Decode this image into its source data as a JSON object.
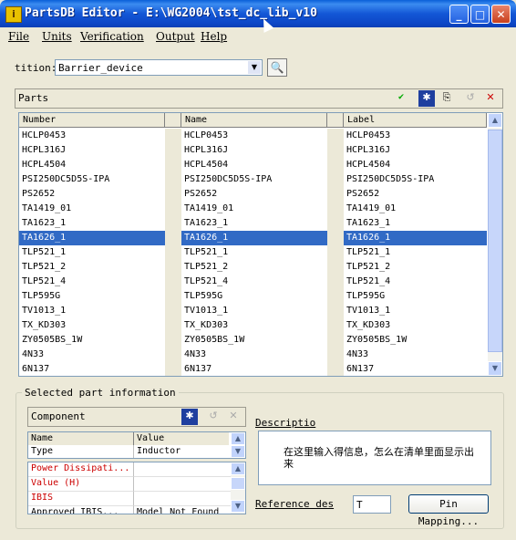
{
  "window": {
    "title": "PartsDB Editor - E:\\WG2004\\tst_dc_lib_v10",
    "minimize": "_",
    "maximize": "□",
    "close": "✕",
    "app_icon": "i"
  },
  "menu": {
    "file": "File",
    "units": "Units",
    "verification": "Verification",
    "output": "Output",
    "help": "Help"
  },
  "partition": {
    "label": "tition:",
    "value": "Barrier_device"
  },
  "parts": {
    "title": "Parts",
    "columns": [
      "Number",
      "Name",
      "Label"
    ],
    "rows": [
      [
        "HCLP0453",
        "HCLP0453",
        "HCLP0453"
      ],
      [
        "HCPL316J",
        "HCPL316J",
        "HCPL316J"
      ],
      [
        "HCPL4504",
        "HCPL4504",
        "HCPL4504"
      ],
      [
        "PSI250DC5D5S-IPA",
        "PSI250DC5D5S-IPA",
        "PSI250DC5D5S-IPA"
      ],
      [
        "PS2652",
        "PS2652",
        "PS2652"
      ],
      [
        "TA1419_01",
        "TA1419_01",
        "TA1419_01"
      ],
      [
        "TA1623_1",
        "TA1623_1",
        "TA1623_1"
      ],
      [
        "TA1626_1",
        "TA1626_1",
        "TA1626_1"
      ],
      [
        "TLP521_1",
        "TLP521_1",
        "TLP521_1"
      ],
      [
        "TLP521_2",
        "TLP521_2",
        "TLP521_2"
      ],
      [
        "TLP521_4",
        "TLP521_4",
        "TLP521_4"
      ],
      [
        "TLP595G",
        "TLP595G",
        "TLP595G"
      ],
      [
        "TV1013_1",
        "TV1013_1",
        "TV1013_1"
      ],
      [
        "TX_KD303",
        "TX_KD303",
        "TX_KD303"
      ],
      [
        "ZY0505BS_1W",
        "ZY0505BS_1W",
        "ZY0505BS_1W"
      ],
      [
        "4N33",
        "4N33",
        "4N33"
      ],
      [
        "6N137",
        "6N137",
        "6N137"
      ]
    ],
    "selected_index": 7
  },
  "info": {
    "legend": "Selected part information",
    "component_title": "Component",
    "prop_headers": [
      "Name",
      "Value"
    ],
    "type_row": [
      "Type",
      "Inductor"
    ],
    "props": [
      [
        "Power Dissipati...",
        ""
      ],
      [
        "Value (H)",
        ""
      ],
      [
        "IBIS",
        ""
      ],
      [
        "Approved IBIS...",
        "Model Not Found"
      ]
    ],
    "description_label": "Descriptio",
    "description_text": "在这里输入得信息，怎么在清单里面显示出来",
    "refdes_label": "Reference des",
    "refdes_value": "T",
    "pin_mapping": "Pin Mapping..."
  },
  "colors": {
    "selection": "#316ac5",
    "required_prop": "#cc0000"
  }
}
